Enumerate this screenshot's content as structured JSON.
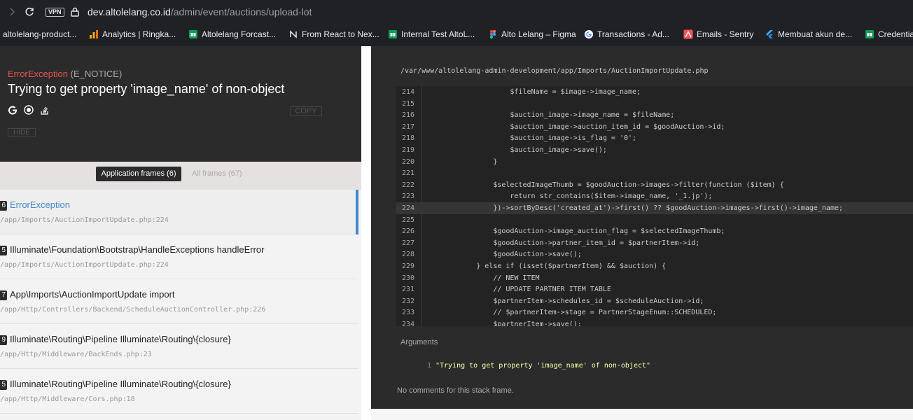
{
  "browser": {
    "vpn_label": "VPN",
    "url_host": "dev.altolelang.co.id",
    "url_path": "/admin/event/auctions/upload-lot"
  },
  "bookmarks": [
    {
      "label": "altolelang-product...",
      "icon": "bookmark-icon"
    },
    {
      "label": "Analytics | Ringka...",
      "icon": "analytics-icon"
    },
    {
      "label": "Altolelang Forcast...",
      "icon": "sheets-icon"
    },
    {
      "label": "From React to Nex...",
      "icon": "next-icon"
    },
    {
      "label": "Internal Test AltoL...",
      "icon": "sheets-icon"
    },
    {
      "label": "Alto Lelang – Figma",
      "icon": "figma-icon"
    },
    {
      "label": "Transactions - Ad...",
      "icon": "google-icon"
    },
    {
      "label": "Emails - Sentry",
      "icon": "sentry-icon"
    },
    {
      "label": "Membuat akun de...",
      "icon": "flutter-icon"
    },
    {
      "label": "Credentia",
      "icon": "sheets-icon"
    }
  ],
  "exception": {
    "class": "ErrorException",
    "level": "(E_NOTICE)",
    "message": "Trying to get property 'image_name' of non-object",
    "copy_label": "COPY",
    "hide_label": "HIDE"
  },
  "tabs": {
    "application": "Application frames (6)",
    "all": "All frames (67)"
  },
  "frames": [
    {
      "num": "6",
      "title": "ErrorException",
      "path": "/app/Imports/AuctionImportUpdate.php:224"
    },
    {
      "num": "5",
      "title": "Illuminate\\Foundation\\Bootstrap\\HandleExceptions handleError",
      "path": "/app/Imports/AuctionImportUpdate.php:224"
    },
    {
      "num": "7",
      "title": "App\\Imports\\AuctionImportUpdate import",
      "path": "/app/Http/Controllers/Backend/ScheduleAuctionController.php:226"
    },
    {
      "num": "9",
      "title": "Illuminate\\Routing\\Pipeline Illuminate\\Routing\\{closure}",
      "path": "/app/Http/Middleware/BackEnds.php:23"
    },
    {
      "num": "5",
      "title": "Illuminate\\Routing\\Pipeline Illuminate\\Routing\\{closure}",
      "path": "/app/Http/Middleware/Cors.php:18"
    }
  ],
  "code": {
    "file": "/var/www/altolelang-admin-development/app/Imports/AuctionImportUpdate.php",
    "highlight_line": 224,
    "lines": [
      {
        "n": "214",
        "text": "                    $fileName = $image->image_name;"
      },
      {
        "n": "215",
        "text": ""
      },
      {
        "n": "216",
        "text": "                    $auction_image->image_name = $fileName;"
      },
      {
        "n": "217",
        "text": "                    $auction_image->auction_item_id = $goodAuction->id;"
      },
      {
        "n": "218",
        "text": "                    $auction_image->is_flag = '0';"
      },
      {
        "n": "219",
        "text": "                    $auction_image->save();"
      },
      {
        "n": "220",
        "text": "                }"
      },
      {
        "n": "221",
        "text": ""
      },
      {
        "n": "222",
        "text": "                $selectedImageThumb = $goodAuction->images->filter(function ($item) {"
      },
      {
        "n": "223",
        "text": "                    return str_contains($item->image_name, '_1.jp');"
      },
      {
        "n": "224",
        "text": "                })->sortByDesc('created_at')->first() ?? $goodAuction->images->first()->image_name;"
      },
      {
        "n": "225",
        "text": ""
      },
      {
        "n": "226",
        "text": "                $goodAuction->image_auction_flag = $selectedImageThumb;"
      },
      {
        "n": "227",
        "text": "                $goodAuction->partner_item_id = $partnerItem->id;"
      },
      {
        "n": "228",
        "text": "                $goodAuction->save();"
      },
      {
        "n": "229",
        "text": "            } else if (isset($partnerItem) && $auction) {"
      },
      {
        "n": "230",
        "text": "                // NEW ITEM"
      },
      {
        "n": "231",
        "text": "                // UPDATE PARTNER ITEM TABLE"
      },
      {
        "n": "232",
        "text": "                $partnerItem->schedules_id = $scheduleAuction->id;"
      },
      {
        "n": "233",
        "text": "                // $partnerItem->stage = PartnerStageEnum::SCHEDULED;"
      },
      {
        "n": "234",
        "text": "                $partnerItem->save();"
      }
    ]
  },
  "arguments": {
    "label": "Arguments",
    "items": [
      {
        "n": "1",
        "value": "\"Trying to get property 'image_name' of non-object\""
      }
    ],
    "no_comments": "No comments for this stack frame."
  },
  "colors": {
    "exception_class": "#e95353",
    "frame_active": "#4288ce",
    "code_bg": "#2b2b2b"
  }
}
